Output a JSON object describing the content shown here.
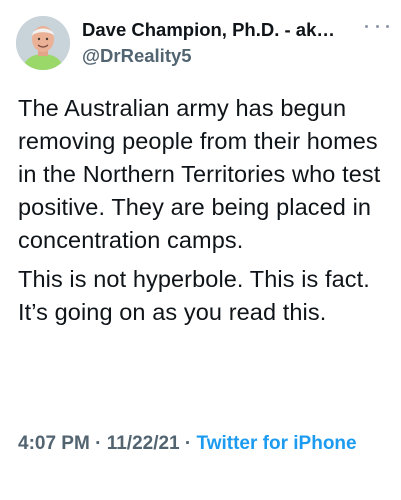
{
  "tweet": {
    "author": {
      "display_name": "Dave Champion, Ph.D. - ak…",
      "handle": "@DrReality5"
    },
    "more_icon": "more-horizontal-icon",
    "paragraphs": [
      "The Australian army has begun removing people from their homes in the Northern Territories who test positive. They are being placed in concentration camps.",
      "This is not hyperbole. This is fact. It’s going on as you read this."
    ],
    "meta": {
      "time": "4:07 PM",
      "separator1": " · ",
      "date": "11/22/21",
      "separator2": " · ",
      "source": "Twitter for iPhone"
    }
  },
  "colors": {
    "text": "#0f1419",
    "secondary": "#536471",
    "link": "#1d9bf0"
  }
}
